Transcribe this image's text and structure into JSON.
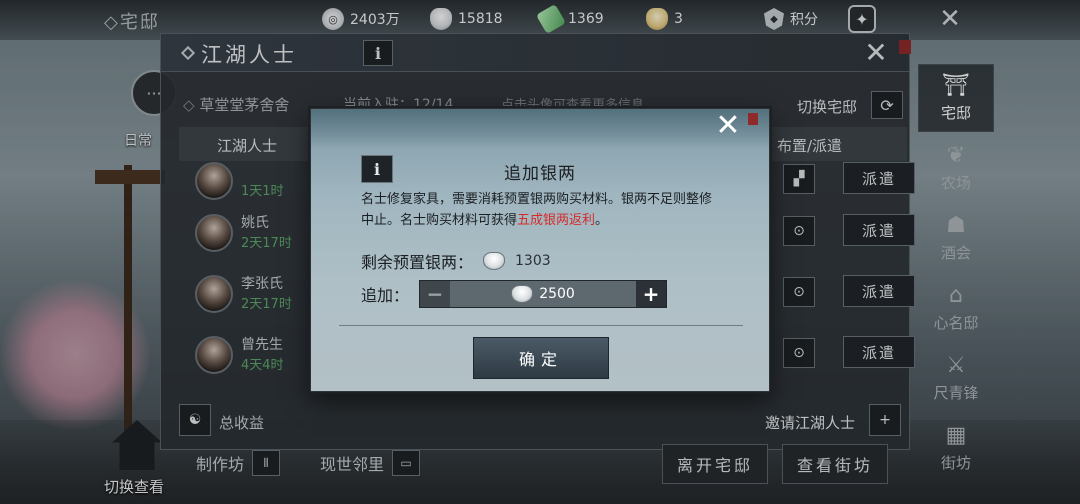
{
  "top_bar": {
    "location": "◇宅邸",
    "resources": [
      {
        "icon": "coin-icon",
        "value": "2403万"
      },
      {
        "icon": "silver-ingot-icon",
        "value": "15818"
      },
      {
        "icon": "jade-icon",
        "value": "1369"
      },
      {
        "icon": "gold-ingot-icon",
        "value": "3"
      }
    ],
    "points_label": "积分",
    "close_glyph": "✕"
  },
  "left": {
    "daily_label": "日常",
    "switch_view_label": "切换查看"
  },
  "right_nav": [
    {
      "label": "宅邸",
      "glyph": "⛩",
      "icon": "mansion-icon",
      "active": true
    },
    {
      "label": "农场",
      "glyph": "❦",
      "icon": "farm-icon",
      "active": false
    },
    {
      "label": "酒会",
      "glyph": "☗",
      "icon": "banquet-icon",
      "active": false
    },
    {
      "label": "心名邸",
      "glyph": "⌂",
      "icon": "estate-icon",
      "active": false
    },
    {
      "label": "尺青锋",
      "glyph": "⚔",
      "icon": "sword-icon",
      "active": false
    },
    {
      "label": "街坊",
      "glyph": "▦",
      "icon": "neighborhood-icon",
      "active": false
    }
  ],
  "panel": {
    "title": "江湖人士",
    "info_glyph": "i",
    "close_glyph": "✕",
    "house_name": "草堂堂茅舍舍",
    "occupancy": "当前入驻：12/14",
    "hint": "点击头像可查看更多信息",
    "switch_house_label": "切换宅邸",
    "columns": {
      "name": "江湖人士",
      "action": "布置/派遣"
    },
    "rows": [
      {
        "name": "",
        "time": "1天1时",
        "dispatch": "派遣"
      },
      {
        "name": "姚氏",
        "time": "2天17时",
        "dispatch": "派遣"
      },
      {
        "name": "李张氏",
        "time": "2天17时",
        "dispatch": "派遣"
      },
      {
        "name": "曾先生",
        "time": "4天4时",
        "dispatch": "派遣"
      }
    ],
    "total_income_label": "总收益",
    "invite_label": "邀请江湖人士"
  },
  "bottom": {
    "workshop_label": "制作坊",
    "neighbors_label": "现世邻里",
    "leave_label": "离开宅邸",
    "view_street_label": "查看街坊"
  },
  "modal": {
    "title": "追加银两",
    "info_glyph": "i",
    "close_glyph": "✕",
    "desc_main": "名士修复家具，需要消耗预置银两购买材料。银两不足则整修中止。名士购买材料可获得",
    "desc_highlight": "五成银两返利",
    "desc_end": "。",
    "remain_label": "剩余预置银两：",
    "remain_value": "1303",
    "add_label": "追加：",
    "add_value": "2500",
    "minus_glyph": "−",
    "plus_glyph": "+",
    "confirm_label": "确定"
  }
}
